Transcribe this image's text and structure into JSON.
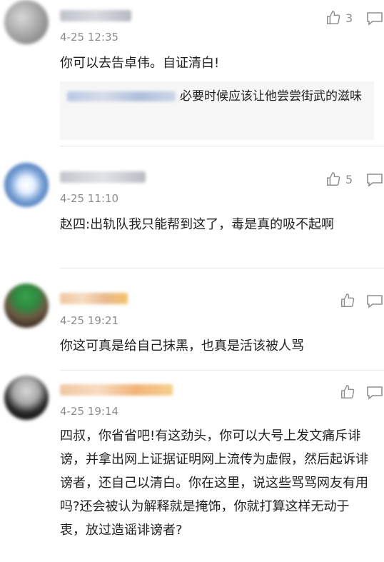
{
  "comments": [
    {
      "time": "4-25 12:35",
      "likes": "3",
      "text": "你可以去告卓伟。自证清白!",
      "reply": "必要时候应该让他尝尝街武的滋味"
    },
    {
      "time": "4-25 11:10",
      "likes": "5",
      "text": "赵四:出轨队我只能帮到这了，毒是真的吸不起啊"
    },
    {
      "time": "4-25 19:21",
      "likes": "",
      "text": "你这可真是给自己抹黑，也真是活该被人骂"
    },
    {
      "time": "4-25 19:14",
      "likes": "",
      "text": "四叔，你省省吧!有这劲头，你可以大号上发文痛斥诽谤，并拿出网上证据证明网上流传为虚假，然后起诉诽谤者，还自己以清白。你在这里，说这些骂骂网友有用吗?还会被认为解释就是掩饰，你就打算这样无动于衷，放过造谣诽谤者?"
    }
  ],
  "icons": {
    "like": "thumbs-up-icon",
    "reply": "reply-icon"
  },
  "colors": {
    "meta": "#8d8d8d",
    "quote_bg": "#f6f6f6"
  }
}
